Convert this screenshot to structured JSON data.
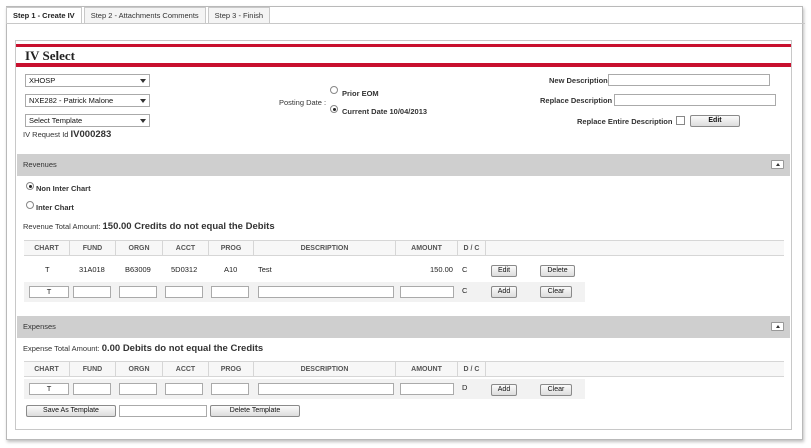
{
  "tabs": [
    "Step 1 - Create IV",
    "Step 2 - Attachments Comments",
    "Step 3 - Finish"
  ],
  "panel_title": "IV Select",
  "top": {
    "select1": "XHOSP",
    "select2": "NXE282 - Patrick Malone",
    "select3": "Select Template",
    "request_label": "IV Request Id",
    "request_id": "IV000283",
    "posting_label": "Posting Date :",
    "prior_eom": "Prior EOM",
    "current_date": "Current Date 10/04/2013",
    "new_desc_label": "New Description",
    "replace_desc_label": "Replace Description",
    "replace_entire_label": "Replace Entire Description",
    "edit_label": "Edit"
  },
  "revenues": {
    "title": "Revenues",
    "non_inter": "Non Inter Chart",
    "inter": "Inter Chart",
    "total_label": "Revenue Total Amount:",
    "total_msg": "150.00 Credits do not equal the Debits",
    "headers": [
      "CHART",
      "FUND",
      "ORGN",
      "ACCT",
      "PROG",
      "DESCRIPTION",
      "AMOUNT",
      "D / C"
    ],
    "row": {
      "chart": "T",
      "fund": "31A018",
      "orgn": "B63009",
      "acct": "5D0312",
      "prog": "A10",
      "desc": "Test",
      "amount": "150.00",
      "dc": "C",
      "edit": "Edit",
      "delete": "Delete"
    },
    "new_row": {
      "chart": "T",
      "dc": "C",
      "add": "Add",
      "clear": "Clear"
    }
  },
  "expenses": {
    "title": "Expenses",
    "total_label": "Expense Total Amount:",
    "total_msg": "0.00 Debits do not equal the Credits",
    "headers": [
      "CHART",
      "FUND",
      "ORGN",
      "ACCT",
      "PROG",
      "DESCRIPTION",
      "AMOUNT",
      "D / C"
    ],
    "new_row": {
      "chart": "T",
      "dc": "D",
      "add": "Add",
      "clear": "Clear"
    }
  },
  "footer": {
    "save_template": "Save As Template",
    "delete_template": "Delete Template"
  }
}
